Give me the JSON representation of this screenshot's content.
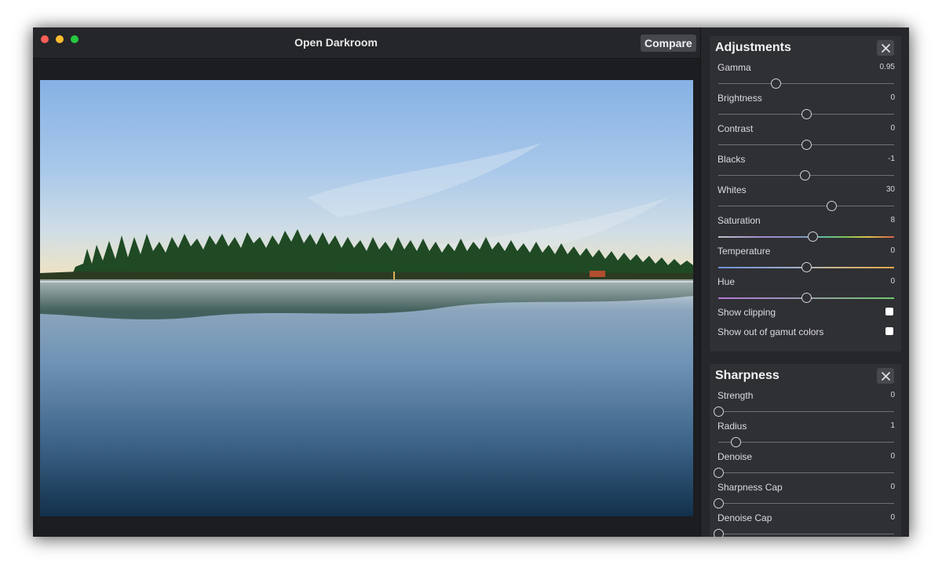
{
  "window": {
    "title": "Open Darkroom",
    "compare_label": "Compare"
  },
  "photo": {
    "description_icon": "landscape-photo",
    "sky_top": "#8fb6e6",
    "sky_horizon": "#f1e6c6",
    "water": "#2f5676"
  },
  "adjustments": {
    "title": "Adjustments",
    "sliders": [
      {
        "label": "Gamma",
        "value": "0.95",
        "position": 0.33,
        "track": "plain"
      },
      {
        "label": "Brightness",
        "value": "0",
        "position": 0.5,
        "track": "plain"
      },
      {
        "label": "Contrast",
        "value": "0",
        "position": 0.5,
        "track": "plain"
      },
      {
        "label": "Blacks",
        "value": "-1",
        "position": 0.495,
        "track": "plain"
      },
      {
        "label": "Whites",
        "value": "30",
        "position": 0.645,
        "track": "plain"
      },
      {
        "label": "Saturation",
        "value": "8",
        "position": 0.54,
        "track": "saturation"
      },
      {
        "label": "Temperature",
        "value": "0",
        "position": 0.5,
        "track": "temperature"
      },
      {
        "label": "Hue",
        "value": "0",
        "position": 0.5,
        "track": "hue"
      }
    ],
    "checkboxes": [
      {
        "label": "Show clipping",
        "checked": false
      },
      {
        "label": "Show out of gamut colors",
        "checked": false
      }
    ]
  },
  "sharpness": {
    "title": "Sharpness",
    "sliders": [
      {
        "label": "Strength",
        "value": "0",
        "position": 0.0,
        "track": "plain"
      },
      {
        "label": "Radius",
        "value": "1",
        "position": 0.1,
        "track": "plain"
      },
      {
        "label": "Denoise",
        "value": "0",
        "position": 0.0,
        "track": "plain"
      },
      {
        "label": "Sharpness Cap",
        "value": "0",
        "position": 0.0,
        "track": "plain"
      },
      {
        "label": "Denoise Cap",
        "value": "0",
        "position": 0.0,
        "track": "plain"
      }
    ]
  },
  "colors": {
    "window_bg": "#1e1f22",
    "panel_bg": "#2f3034",
    "button_bg": "#46484d"
  }
}
